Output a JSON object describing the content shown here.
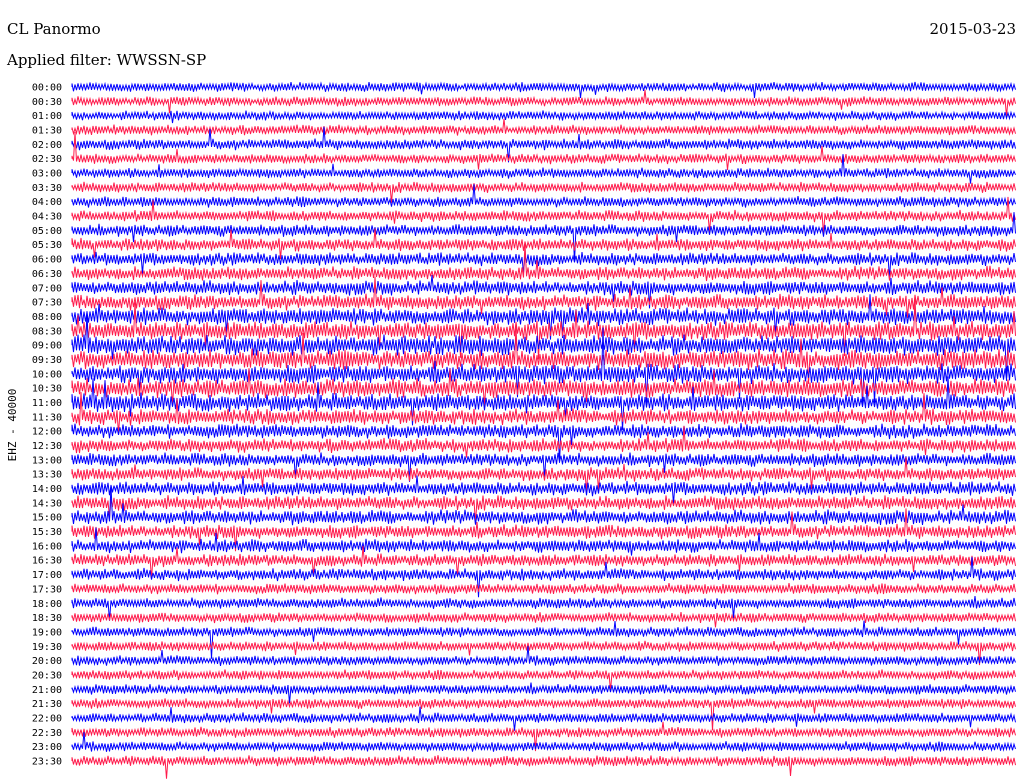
{
  "header": {
    "station": "CL Panormo",
    "date": "2015-03-23",
    "filter_prefix": "Applied filter:",
    "filter_name": "WWSSN-SP"
  },
  "chart_data": {
    "type": "line",
    "title": "CL Panormo",
    "ylabel": "EHZ - 40000",
    "row_labels": [
      "00:00",
      "00:30",
      "01:00",
      "01:30",
      "02:00",
      "02:30",
      "03:00",
      "03:30",
      "04:00",
      "04:30",
      "05:00",
      "05:30",
      "06:00",
      "06:30",
      "07:00",
      "07:30",
      "08:00",
      "08:30",
      "09:00",
      "09:30",
      "10:00",
      "10:30",
      "11:00",
      "11:30",
      "12:00",
      "12:30",
      "13:00",
      "13:30",
      "14:00",
      "14:30",
      "15:00",
      "15:30",
      "16:00",
      "16:30",
      "17:00",
      "17:30",
      "18:00",
      "18:30",
      "19:00",
      "19:30",
      "20:00",
      "20:30",
      "21:00",
      "21:30",
      "22:00",
      "22:30",
      "23:00",
      "23:30"
    ],
    "row_colors": [
      "#0000ff",
      "#ff1a4b"
    ],
    "row_activity": [
      0.2,
      0.2,
      0.2,
      0.25,
      0.3,
      0.25,
      0.25,
      0.3,
      0.3,
      0.35,
      0.4,
      0.45,
      0.5,
      0.55,
      0.6,
      0.65,
      0.8,
      0.9,
      1.0,
      1.0,
      0.95,
      0.9,
      0.85,
      0.7,
      0.6,
      0.55,
      0.5,
      0.5,
      0.55,
      0.6,
      0.6,
      0.55,
      0.5,
      0.45,
      0.4,
      0.3,
      0.3,
      0.25,
      0.25,
      0.25,
      0.25,
      0.25,
      0.25,
      0.25,
      0.25,
      0.25,
      0.25,
      0.3
    ],
    "grid": false
  }
}
